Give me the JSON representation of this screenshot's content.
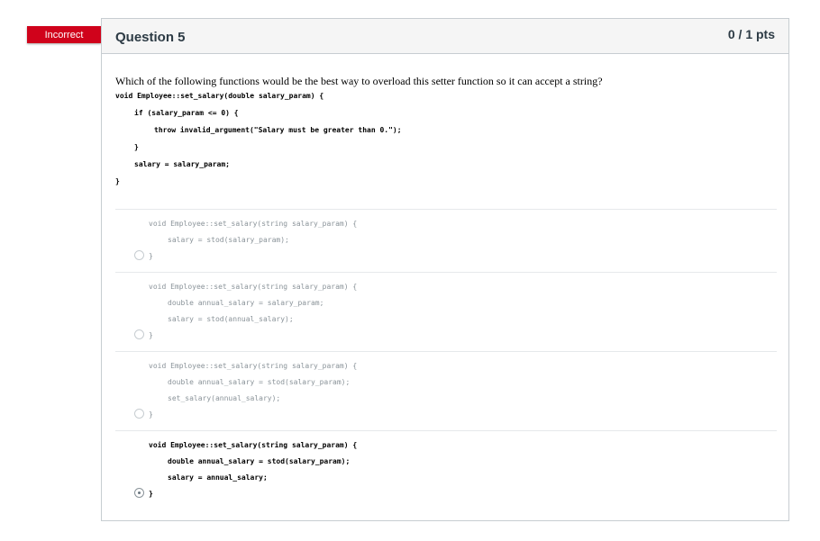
{
  "flag": {
    "label": "Incorrect",
    "color": "#d0021b"
  },
  "question": {
    "title": "Question 5",
    "points": "0 / 1 pts",
    "prompt": "Which of the following functions would be the best way to overload this setter function so it can accept a string?",
    "code": [
      "void Employee::set_salary(double salary_param) {",
      "if (salary_param <= 0) {",
      "throw invalid_argument(\"Salary must be greater than 0.\");",
      "}",
      "salary = salary_param;",
      "}"
    ]
  },
  "answers": [
    {
      "lines": [
        "void Employee::set_salary(string salary_param) {",
        "salary = stod(salary_param);",
        "}"
      ],
      "selected": false
    },
    {
      "lines": [
        "void Employee::set_salary(string salary_param) {",
        "double annual_salary = salary_param;",
        "salary = stod(annual_salary);",
        "}"
      ],
      "selected": false
    },
    {
      "lines": [
        "void Employee::set_salary(string salary_param) {",
        "double annual_salary = stod(salary_param);",
        "set_salary(annual_salary);",
        "}"
      ],
      "selected": false
    },
    {
      "lines": [
        "void Employee::set_salary(string salary_param) {",
        "double annual_salary = stod(salary_param);",
        "salary = annual_salary;",
        "}"
      ],
      "selected": true
    }
  ]
}
